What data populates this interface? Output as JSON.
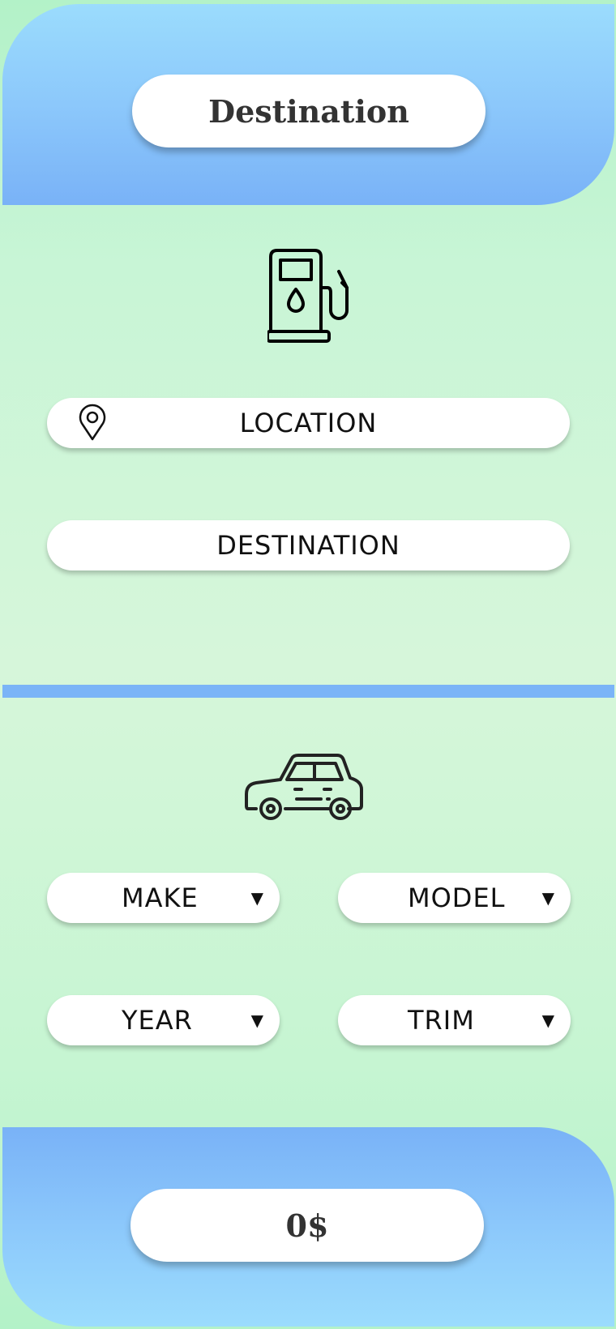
{
  "header": {
    "title": "Destination"
  },
  "route": {
    "icon": "fuel-pump-icon",
    "location_label": "LOCATION",
    "location_icon": "map-pin-icon",
    "destination_label": "DESTINATION"
  },
  "vehicle": {
    "icon": "car-icon",
    "make_label": "MAKE",
    "model_label": "MODEL",
    "year_label": "YEAR",
    "trim_label": "TRIM",
    "dropdown_arrow": "▼"
  },
  "footer": {
    "total": "0$"
  },
  "colors": {
    "accent_blue": "#79b2f7",
    "light_blue": "#9bdcfd",
    "background_green": "#c8f5d6",
    "field_background": "#ffffff",
    "text_dark": "#333333"
  }
}
